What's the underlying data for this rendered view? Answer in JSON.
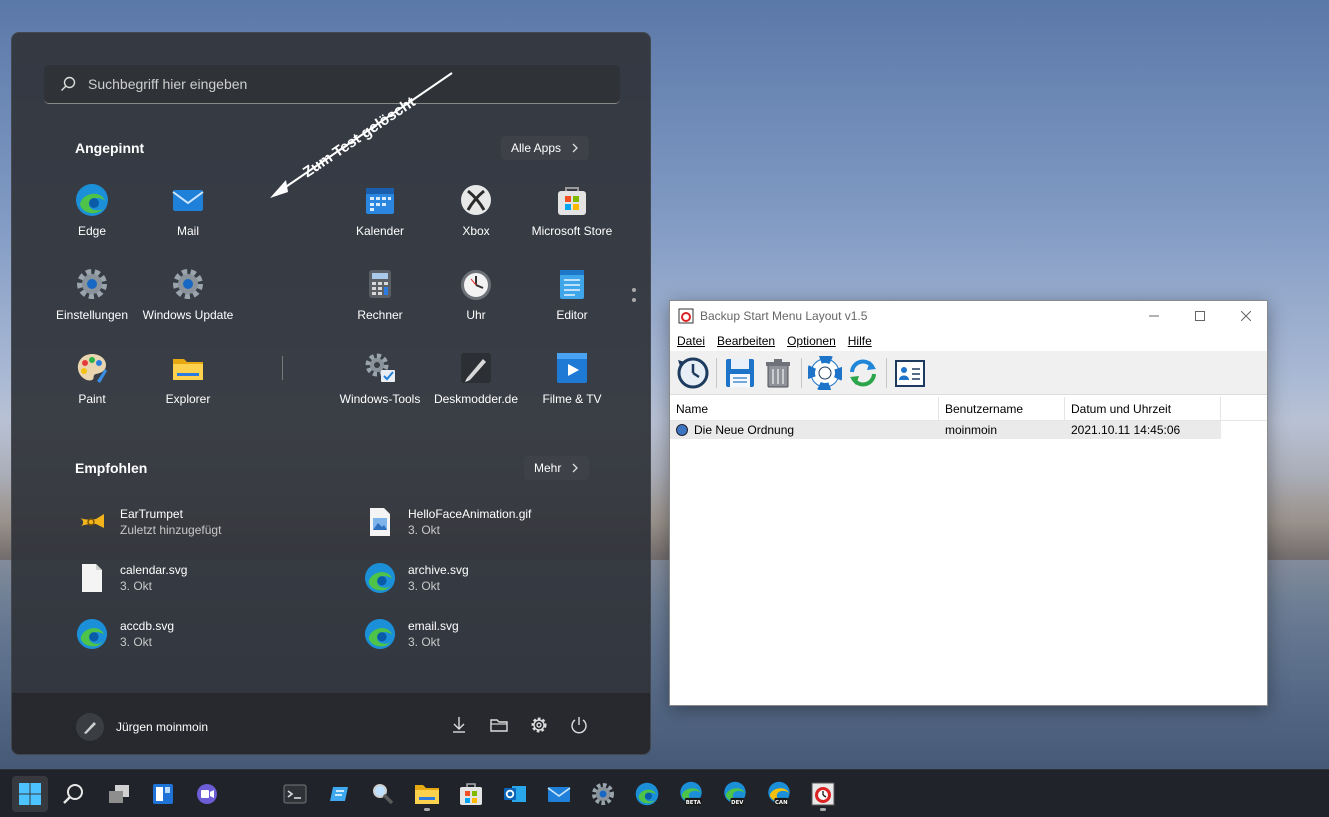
{
  "start_menu": {
    "search_placeholder": "Suchbegriff hier eingeben",
    "pinned_title": "Angepinnt",
    "all_apps_label": "Alle Apps",
    "annotation": "Zum Test gelöscht",
    "pinned": [
      {
        "label": "Edge",
        "icon": "edge-icon"
      },
      {
        "label": "Mail",
        "icon": "mail-icon"
      },
      {
        "label": "Kalender",
        "icon": "calendar-icon"
      },
      {
        "label": "Xbox",
        "icon": "xbox-icon"
      },
      {
        "label": "Microsoft Store",
        "icon": "store-icon"
      },
      {
        "label": "Einstellungen",
        "icon": "gear-icon"
      },
      {
        "label": "Windows Update",
        "icon": "gear-icon"
      },
      {
        "label": "Rechner",
        "icon": "calculator-icon"
      },
      {
        "label": "Uhr",
        "icon": "clock-icon"
      },
      {
        "label": "Editor",
        "icon": "notepad-icon"
      },
      {
        "label": "Paint",
        "icon": "paint-icon"
      },
      {
        "label": "Explorer",
        "icon": "folder-icon"
      },
      {
        "label": "Windows-Tools",
        "icon": "tools-icon"
      },
      {
        "label": "Deskmodder.de",
        "icon": "pen-icon"
      },
      {
        "label": "Filme & TV",
        "icon": "video-icon"
      }
    ],
    "recommended_title": "Empfohlen",
    "more_label": "Mehr",
    "recommended": [
      {
        "name": "EarTrumpet",
        "sub": "Zuletzt hinzugefügt",
        "icon": "eartrumpet-icon"
      },
      {
        "name": "HelloFaceAnimation.gif",
        "sub": "3. Okt",
        "icon": "image-file-icon"
      },
      {
        "name": "calendar.svg",
        "sub": "3. Okt",
        "icon": "file-icon"
      },
      {
        "name": "archive.svg",
        "sub": "3. Okt",
        "icon": "edge-icon"
      },
      {
        "name": "accdb.svg",
        "sub": "3. Okt",
        "icon": "edge-icon"
      },
      {
        "name": "email.svg",
        "sub": "3. Okt",
        "icon": "edge-icon"
      }
    ],
    "user_name": "Jürgen moinmoin"
  },
  "backup_window": {
    "title": "Backup Start Menu Layout v1.5",
    "menu": [
      "Datei",
      "Bearbeiten",
      "Optionen",
      "Hilfe"
    ],
    "columns": [
      "Name",
      "Benutzername",
      "Datum und Uhrzeit"
    ],
    "rows": [
      {
        "name": "Die Neue Ordnung",
        "user": "moinmoin",
        "datetime": "2021.10.11 14:45:06"
      }
    ]
  },
  "taskbar": {
    "badges": {
      "beta": "BETA",
      "dev": "DEV",
      "can": "CAN"
    }
  }
}
